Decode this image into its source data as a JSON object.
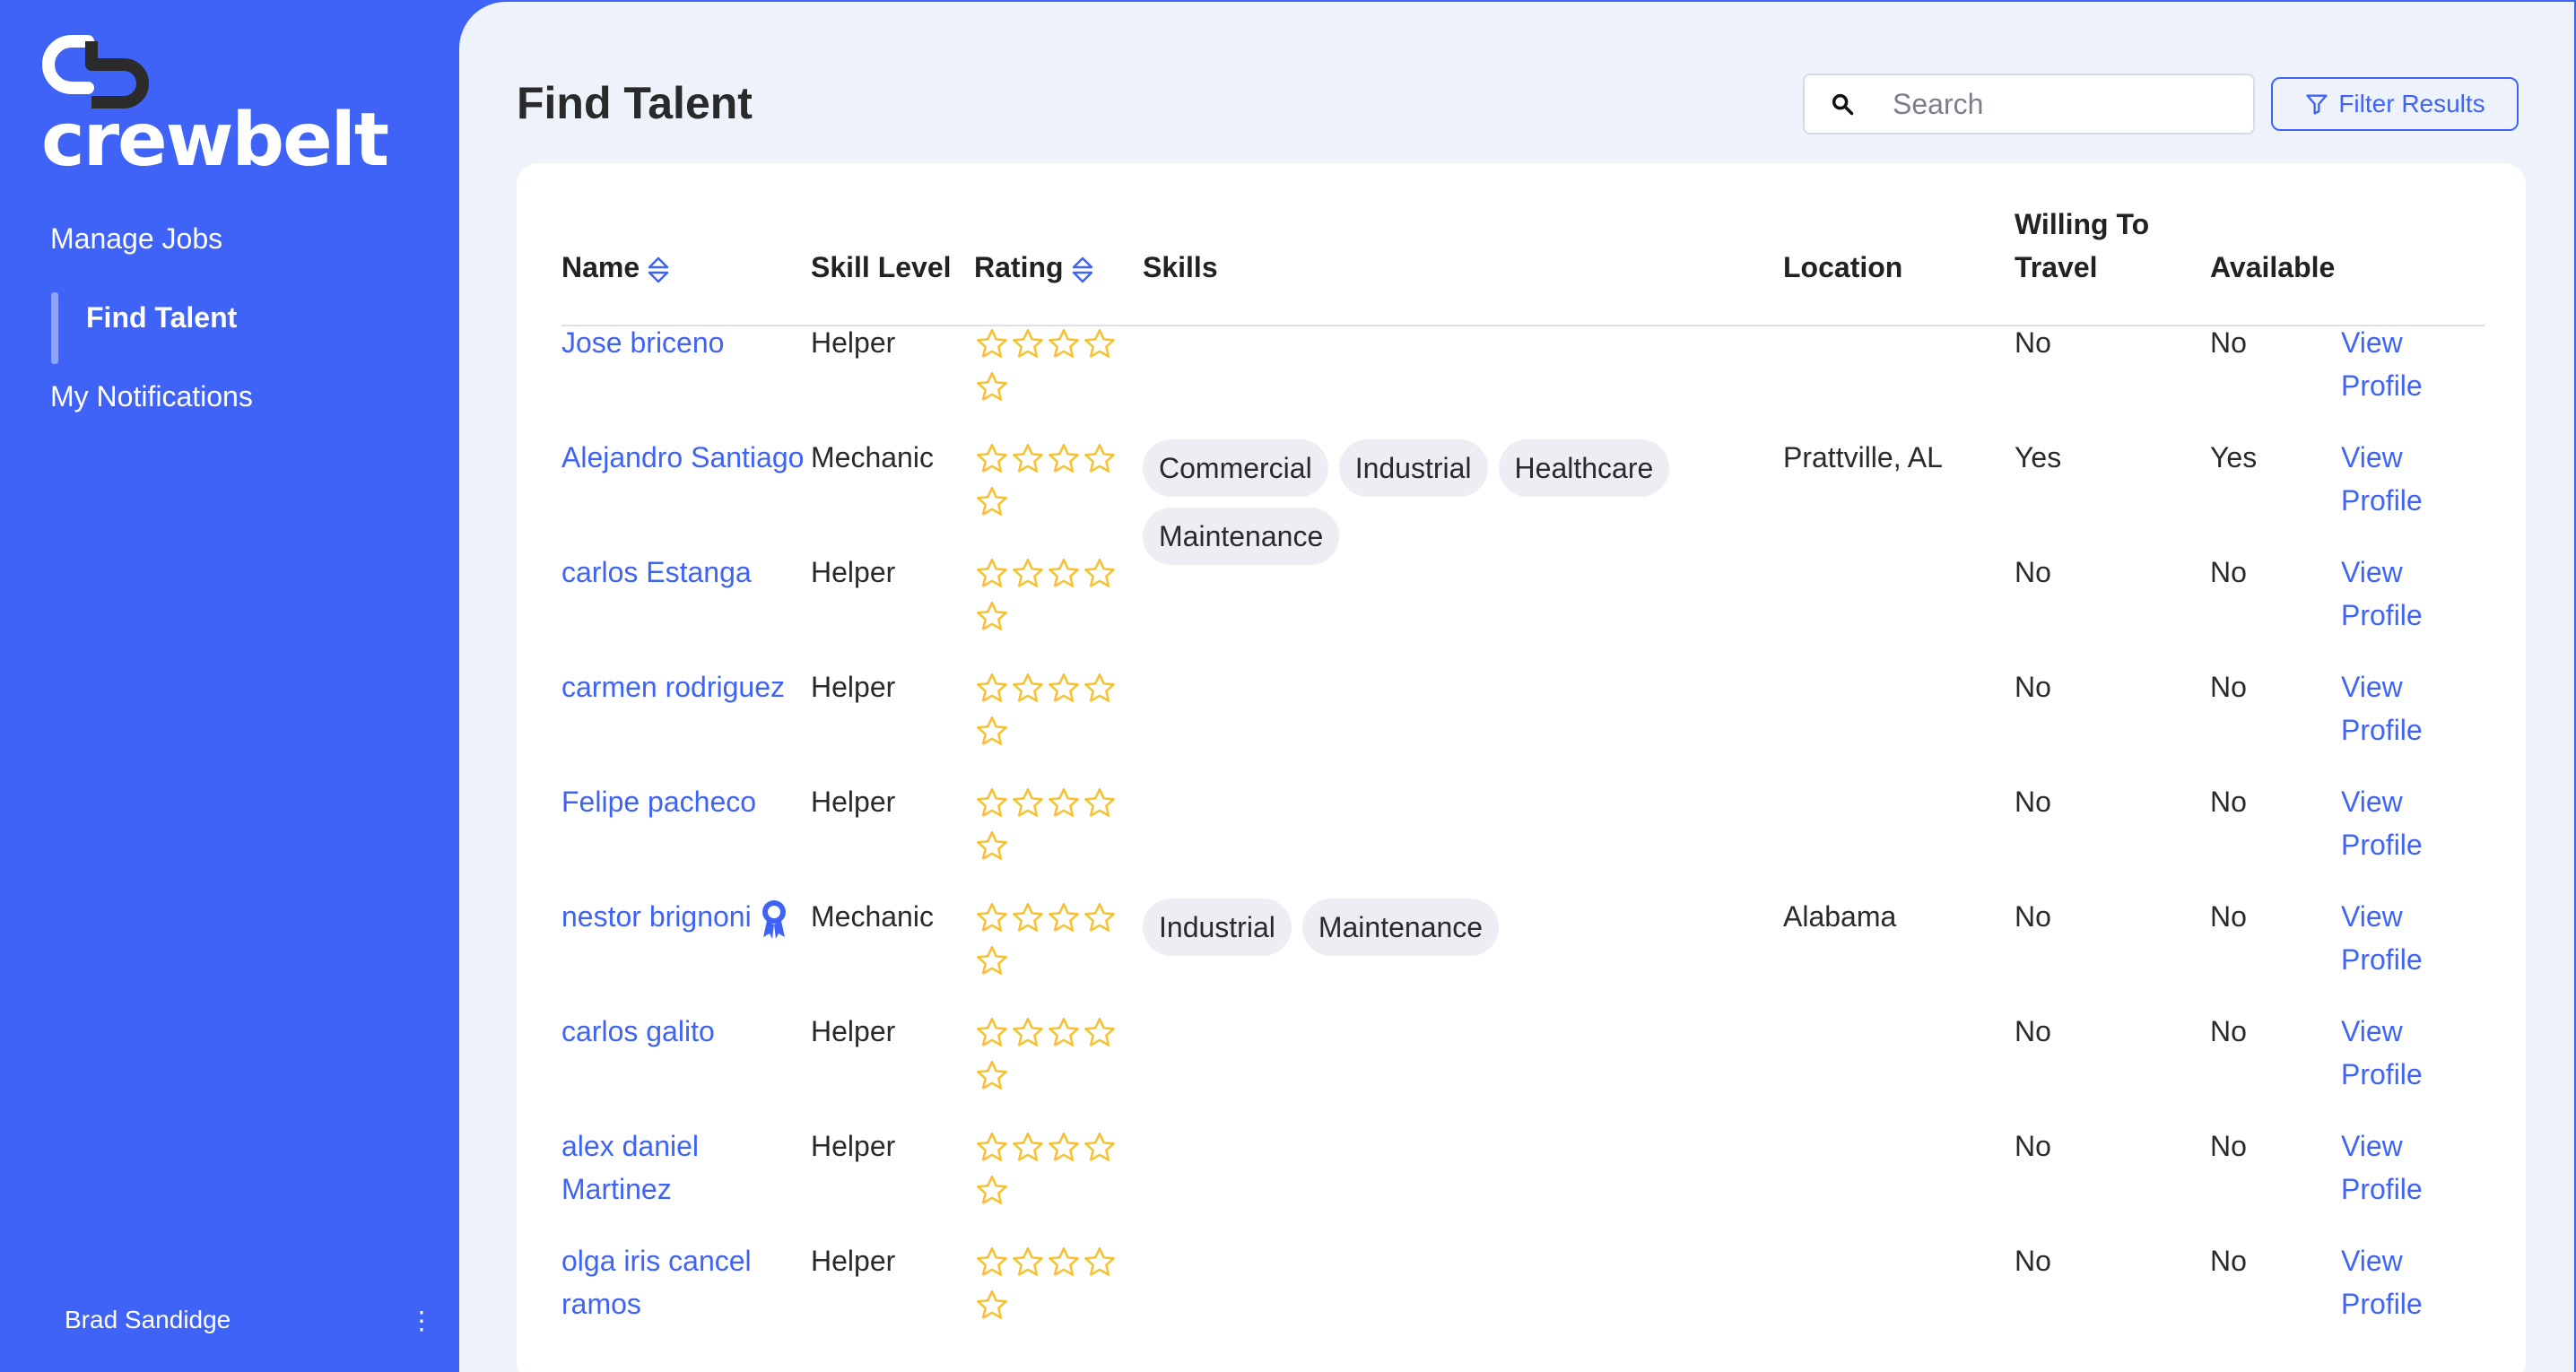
{
  "brand": {
    "name": "crewbelt",
    "accent": "#3f63f7"
  },
  "sidebar": {
    "items": [
      {
        "label": "Manage Jobs"
      },
      {
        "label": "Find Talent"
      },
      {
        "label": "My Notifications"
      }
    ],
    "user": {
      "name": "Brad Sandidge"
    }
  },
  "header": {
    "title": "Find Talent",
    "search_placeholder": "Search",
    "filter_label": "Filter Results"
  },
  "table": {
    "columns": [
      "Name",
      "Skill Level",
      "Rating",
      "Skills",
      "Location",
      "Willing To Travel",
      "Available"
    ],
    "rows": [
      {
        "name": "Jose briceno",
        "level": "Helper",
        "rating": 0,
        "skills": [],
        "location": "",
        "travel": "No",
        "available": "No",
        "action": "View Profile"
      },
      {
        "name": "Alejandro Santiago",
        "level": "Mechanic",
        "rating": 0,
        "skills": [
          "Commercial",
          "Industrial",
          "Healthcare",
          "Maintenance"
        ],
        "location": "Prattville, AL",
        "travel": "Yes",
        "available": "Yes",
        "action": "View Profile"
      },
      {
        "name": "carlos Estanga",
        "level": "Helper",
        "rating": 0,
        "skills": [],
        "location": "",
        "travel": "No",
        "available": "No",
        "action": "View Profile"
      },
      {
        "name": "carmen rodriguez",
        "level": "Helper",
        "rating": 0,
        "skills": [],
        "location": "",
        "travel": "No",
        "available": "No",
        "action": "View Profile"
      },
      {
        "name": "Felipe pacheco",
        "level": "Helper",
        "rating": 0,
        "skills": [],
        "location": "",
        "travel": "No",
        "available": "No",
        "action": "View Profile"
      },
      {
        "name": "nestor brignoni",
        "level": "Mechanic",
        "rating": 0,
        "skills": [
          "Industrial",
          "Maintenance"
        ],
        "location": "Alabama",
        "travel": "No",
        "available": "No",
        "action": "View Profile",
        "badge": "award-icon"
      },
      {
        "name": "carlos galito",
        "level": "Helper",
        "rating": 0,
        "skills": [],
        "location": "",
        "travel": "No",
        "available": "No",
        "action": "View Profile"
      },
      {
        "name": "alex daniel Martinez",
        "level": "Helper",
        "rating": 0,
        "skills": [],
        "location": "",
        "travel": "No",
        "available": "No",
        "action": "View Profile"
      },
      {
        "name": "olga iris cancel ramos",
        "level": "Helper",
        "rating": 0,
        "skills": [],
        "location": "",
        "travel": "No",
        "available": "No",
        "action": "View Profile"
      }
    ]
  },
  "colors": {
    "star": "#f6c02e",
    "link": "#3f63f7",
    "chip": "#eceef3"
  }
}
